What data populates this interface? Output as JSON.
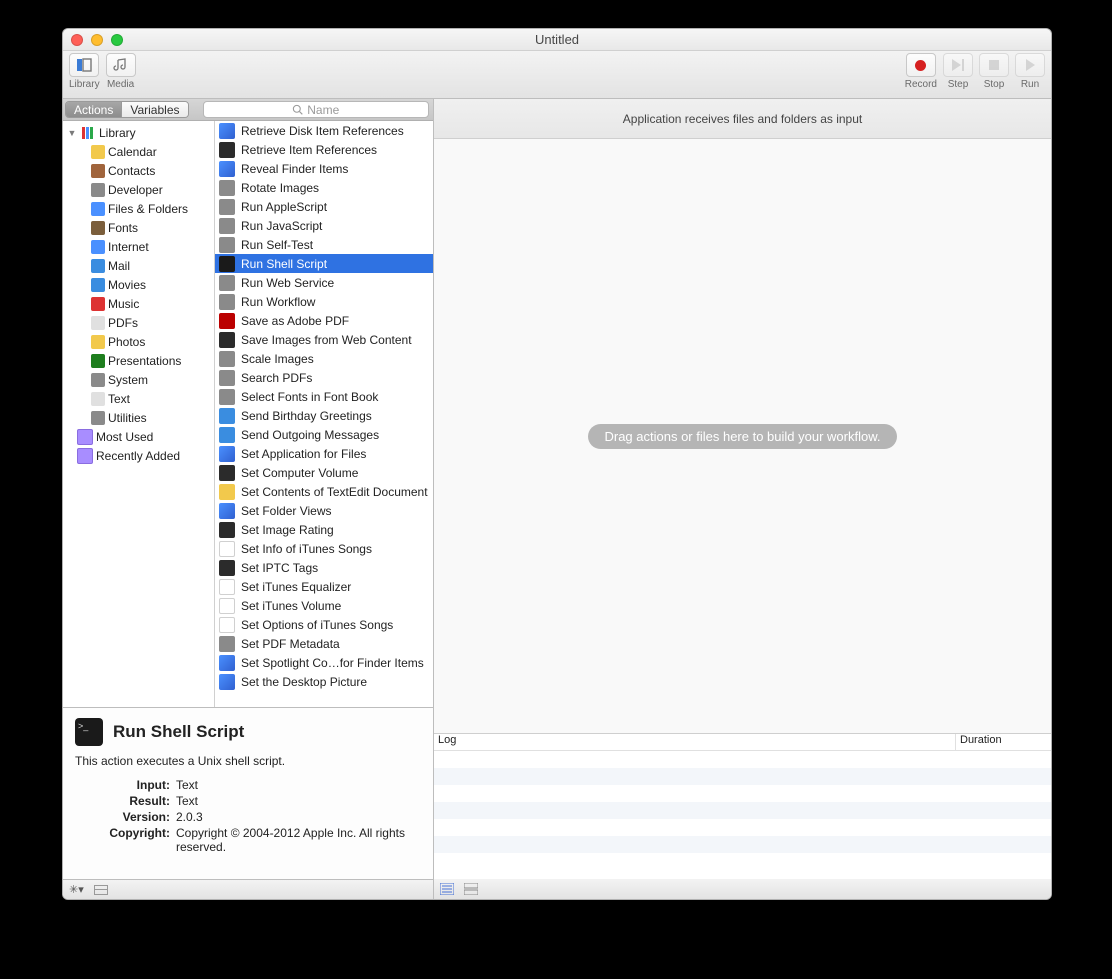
{
  "window": {
    "title": "Untitled"
  },
  "toolbar": {
    "left": [
      {
        "label": "Library"
      },
      {
        "label": "Media"
      }
    ],
    "right": [
      {
        "label": "Record"
      },
      {
        "label": "Step"
      },
      {
        "label": "Stop"
      },
      {
        "label": "Run"
      }
    ]
  },
  "tabs": {
    "actions": "Actions",
    "variables": "Variables"
  },
  "search": {
    "placeholder": "Name"
  },
  "library": {
    "root": "Library",
    "groups": [
      "Calendar",
      "Contacts",
      "Developer",
      "Files & Folders",
      "Fonts",
      "Internet",
      "Mail",
      "Movies",
      "Music",
      "PDFs",
      "Photos",
      "Presentations",
      "System",
      "Text",
      "Utilities"
    ],
    "smart": [
      "Most Used",
      "Recently Added"
    ]
  },
  "actions": [
    "Retrieve Disk Item References",
    "Retrieve Item References",
    "Reveal Finder Items",
    "Rotate Images",
    "Run AppleScript",
    "Run JavaScript",
    "Run Self-Test",
    "Run Shell Script",
    "Run Web Service",
    "Run Workflow",
    "Save as Adobe PDF",
    "Save Images from Web Content",
    "Scale Images",
    "Search PDFs",
    "Select Fonts in Font Book",
    "Send Birthday Greetings",
    "Send Outgoing Messages",
    "Set Application for Files",
    "Set Computer Volume",
    "Set Contents of TextEdit Document",
    "Set Folder Views",
    "Set Image Rating",
    "Set Info of iTunes Songs",
    "Set IPTC Tags",
    "Set iTunes Equalizer",
    "Set iTunes Volume",
    "Set Options of iTunes Songs",
    "Set PDF Metadata",
    "Set Spotlight Co…for Finder Items",
    "Set the Desktop Picture"
  ],
  "selected_action_index": 7,
  "detail": {
    "title": "Run Shell Script",
    "desc": "This action executes a Unix shell script.",
    "kv": {
      "Input": "Text",
      "Result": "Text",
      "Version": "2.0.3",
      "Copyright": "Copyright © 2004-2012 Apple Inc.  All rights reserved."
    }
  },
  "workflow": {
    "input_desc": "Application receives files and folders as input",
    "hint": "Drag actions or files here to build your workflow."
  },
  "log": {
    "col1": "Log",
    "col2": "Duration"
  }
}
